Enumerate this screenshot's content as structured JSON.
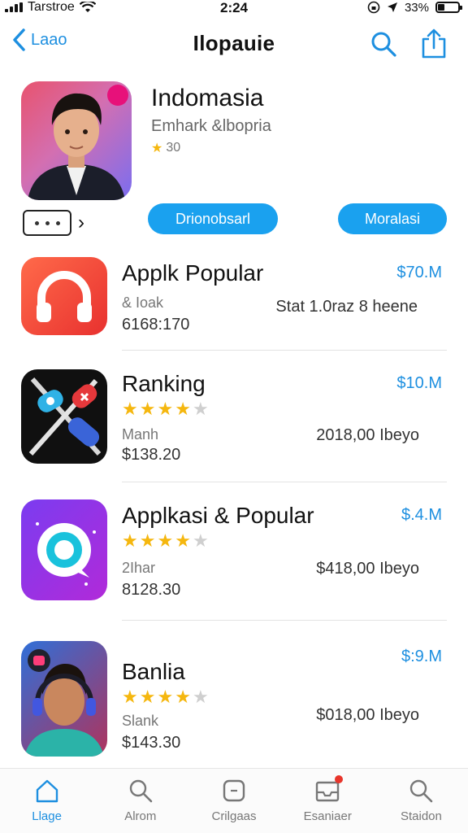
{
  "status_bar": {
    "carrier": "Tarstroe",
    "time": "2:24",
    "battery": "33%",
    "battery_level": 0.33
  },
  "nav": {
    "back_label": "Laao",
    "title": "Ilopauie"
  },
  "featured": {
    "title": "Indomasia",
    "subtitle": "Emhark &lbopria",
    "rating": "30",
    "button_primary": "Drionobsarl",
    "button_secondary": "Moralasi"
  },
  "apps": [
    {
      "name": "Applk Popular",
      "price": "$70.M",
      "meta": "& Ioak",
      "size": "6168:170",
      "detail": "Stat 1.0raz 8 heene",
      "stars": null
    },
    {
      "name": "Ranking",
      "price": "$10.M",
      "meta": "Manh",
      "size": "$138.20",
      "detail": "2018,00 Ibeyo",
      "stars": 4.5
    },
    {
      "name": "Applkasi & Popular",
      "price": "$.4.M",
      "meta": "2Ihar",
      "size": "8128.30",
      "detail": "$418,00 Ibeyo",
      "stars": 4.5
    },
    {
      "name": "Banlia",
      "price": "$:9.M",
      "meta": "Slank",
      "size": "$143.30",
      "detail": "$018,00 Ibeyo",
      "stars": 4.5
    }
  ],
  "tabs": [
    {
      "label": "Llage",
      "icon": "home-icon",
      "active": true
    },
    {
      "label": "Alrom",
      "icon": "search-icon",
      "active": false
    },
    {
      "label": "Crilgaas",
      "icon": "category-icon",
      "active": false
    },
    {
      "label": "Esaniaer",
      "icon": "inbox-icon",
      "active": false,
      "badge": true
    },
    {
      "label": "Staidon",
      "icon": "search-icon",
      "active": false
    }
  ],
  "colors": {
    "accent": "#1d8fe0",
    "pill": "#1aa1ef",
    "star": "#f5b70f",
    "badge": "#e8352b"
  }
}
